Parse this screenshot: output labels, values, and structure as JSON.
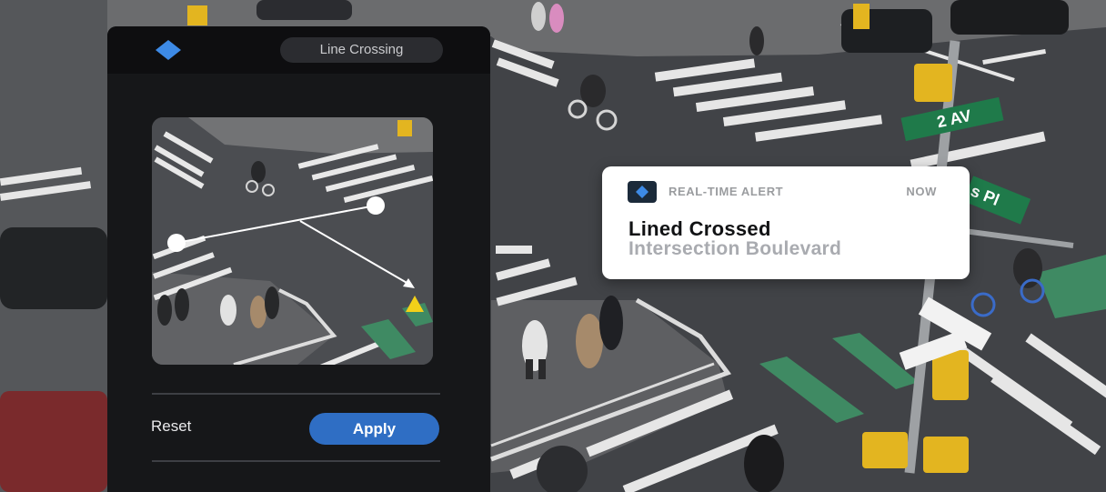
{
  "panel": {
    "mode_label": "Line Crossing",
    "reset_label": "Reset",
    "apply_label": "Apply",
    "logo_icon": "diamond-logo-icon",
    "accent_color": "#2f6ec4"
  },
  "alert": {
    "label": "REAL-TIME ALERT",
    "time": "NOW",
    "title": "Lined Crossed",
    "subtitle": "Intersection Boulevard",
    "icon": "diamond-logo-icon"
  },
  "street_signs": {
    "sign_2av": "2 AV",
    "sign_sp": "s Pl"
  }
}
